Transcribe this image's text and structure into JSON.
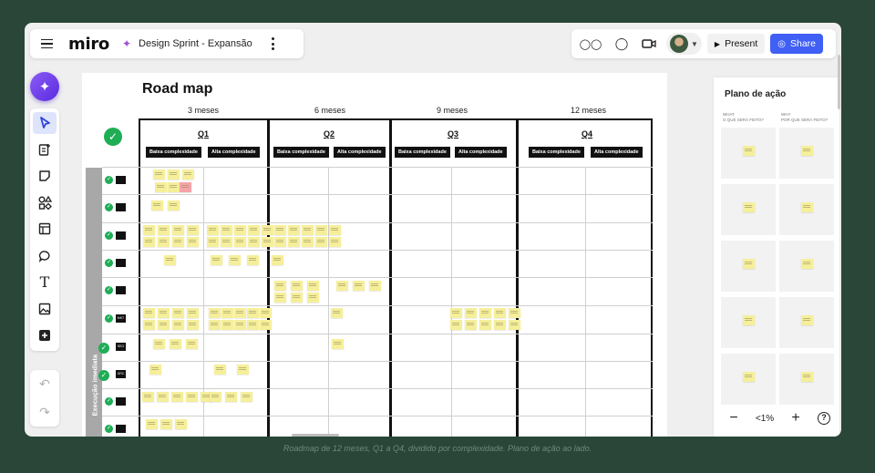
{
  "app": {
    "logo": "miro",
    "board_title": "Design Sprint - Expansão"
  },
  "topbar": {
    "present_label": "Present",
    "share_label": "Share",
    "colors": {
      "share": "#3f5ff5",
      "ai": "#7b4cf0"
    }
  },
  "toolbar": {
    "tools": [
      "select-icon",
      "templates-icon",
      "sticky-note-icon",
      "shapes-icon",
      "frame-icon",
      "comment-icon",
      "text-icon",
      "image-icon",
      "more-apps-icon"
    ],
    "active": "select-icon"
  },
  "board": {
    "title": "Road map",
    "months": [
      "3 meses",
      "6 meses",
      "9 meses",
      "12 meses"
    ],
    "quarters": [
      "Q1",
      "Q2",
      "Q3",
      "Q4"
    ],
    "low_label": "Baixa complexidade",
    "high_label": "Alta complexidade",
    "side_label": "Execução imediata",
    "row_logos": [
      "",
      "",
      "",
      "",
      "",
      "MKT",
      "SEO",
      "GRC",
      "",
      ""
    ]
  },
  "panel": {
    "title": "Plano de ação",
    "col_what": "WHAT",
    "col_what_sub": "O QUE SERÁ FEITO?",
    "col_why": "WHY",
    "col_why_sub": "POR QUE SERÁ FEITO?"
  },
  "zoom": {
    "value": "<1%"
  },
  "caption": "Roadmap de 12 meses, Q1 a Q4, dividido por complexidade. Plano de ação ao lado."
}
